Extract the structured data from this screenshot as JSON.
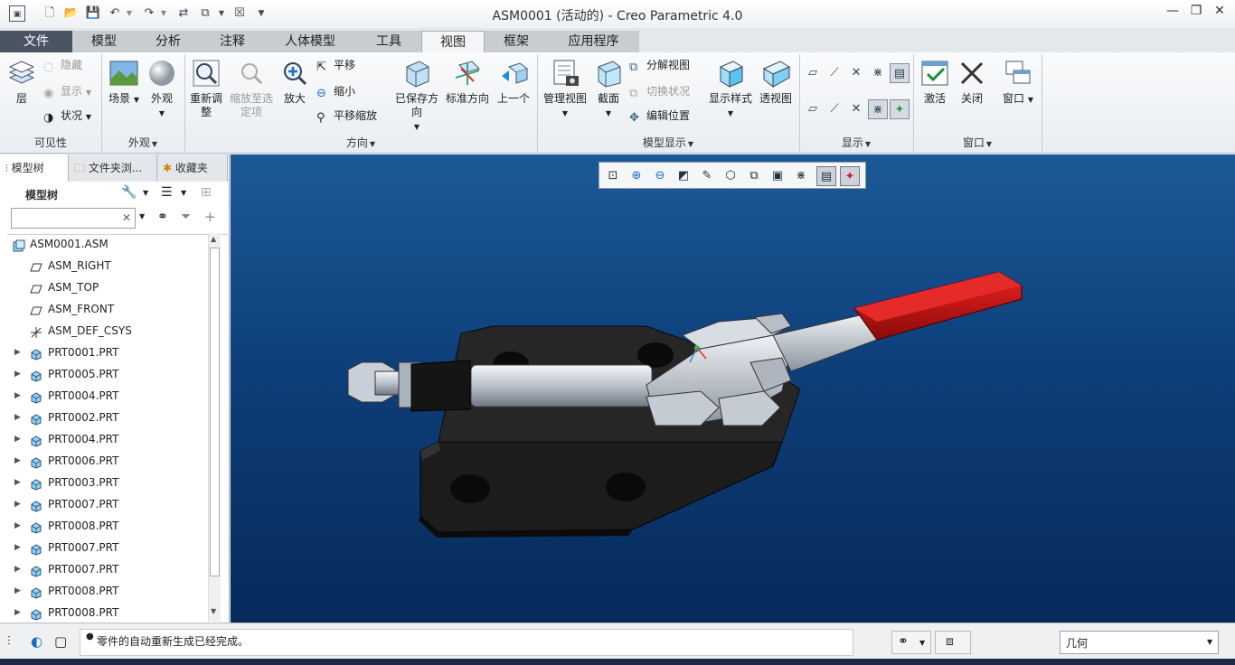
{
  "window": {
    "title": "ASM0001 (活动的) - Creo Parametric 4.0"
  },
  "quick_access": [
    "app-icon",
    "new-icon",
    "open-icon",
    "save-icon",
    "undo-icon",
    "redo-icon",
    "regenerate-icon",
    "window-icon",
    "close-window-icon",
    "customize-icon"
  ],
  "tabs": [
    "文件",
    "模型",
    "分析",
    "注释",
    "人体模型",
    "工具",
    "视图",
    "框架",
    "应用程序"
  ],
  "active_tab": "视图",
  "ribbon": {
    "visibility": {
      "layers": "层",
      "hide": "隐藏",
      "show": "显示",
      "status": "状况",
      "label": "可见性"
    },
    "appearance": {
      "scene": "场景",
      "appearance": "外观",
      "label": "外观"
    },
    "orientation": {
      "refit": "重新调整",
      "zoom_to_selected": "缩放至选定项",
      "zoom_in": "放大",
      "pan": "平移",
      "zoom_out": "缩小",
      "pan_zoom": "平移缩放",
      "saved_orientations": "已保存方向",
      "standard_orientation": "标准方向",
      "previous": "上一个",
      "label": "方向"
    },
    "model_display": {
      "manage_views": "管理视图",
      "section": "截面",
      "exploded_view": "分解视图",
      "toggle_status": "切换状况",
      "edit_position": "编辑位置",
      "display_style": "显示样式",
      "perspective_view": "透视图",
      "label": "模型显示"
    },
    "show": {
      "label": "显示"
    },
    "window": {
      "activate": "激活",
      "close": "关闭",
      "windows": "窗口",
      "label": "窗口"
    }
  },
  "left_panel": {
    "tabs": [
      "模型树",
      "文件夹浏...",
      "收藏夹"
    ],
    "tree_title": "模型树",
    "search_placeholder": "",
    "tree": [
      {
        "label": "ASM0001.ASM",
        "type": "asm"
      },
      {
        "label": "ASM_RIGHT",
        "type": "plane"
      },
      {
        "label": "ASM_TOP",
        "type": "plane"
      },
      {
        "label": "ASM_FRONT",
        "type": "plane"
      },
      {
        "label": "ASM_DEF_CSYS",
        "type": "csys"
      },
      {
        "label": "PRT0001.PRT",
        "type": "part"
      },
      {
        "label": "PRT0005.PRT",
        "type": "part"
      },
      {
        "label": "PRT0004.PRT",
        "type": "part"
      },
      {
        "label": "PRT0002.PRT",
        "type": "part"
      },
      {
        "label": "PRT0004.PRT",
        "type": "part"
      },
      {
        "label": "PRT0006.PRT",
        "type": "part"
      },
      {
        "label": "PRT0003.PRT",
        "type": "part"
      },
      {
        "label": "PRT0007.PRT",
        "type": "part"
      },
      {
        "label": "PRT0008.PRT",
        "type": "part"
      },
      {
        "label": "PRT0007.PRT",
        "type": "part"
      },
      {
        "label": "PRT0007.PRT",
        "type": "part"
      },
      {
        "label": "PRT0008.PRT",
        "type": "part"
      },
      {
        "label": "PRT0008.PRT",
        "type": "part"
      }
    ]
  },
  "status": {
    "message": "零件的自动重新生成已经完成。",
    "filter": "几何"
  },
  "colors": {
    "file_tab": "#4a5463",
    "handle_red": "#c81414",
    "viewport_top": "#1c5a98",
    "viewport_bottom": "#062a5a"
  }
}
